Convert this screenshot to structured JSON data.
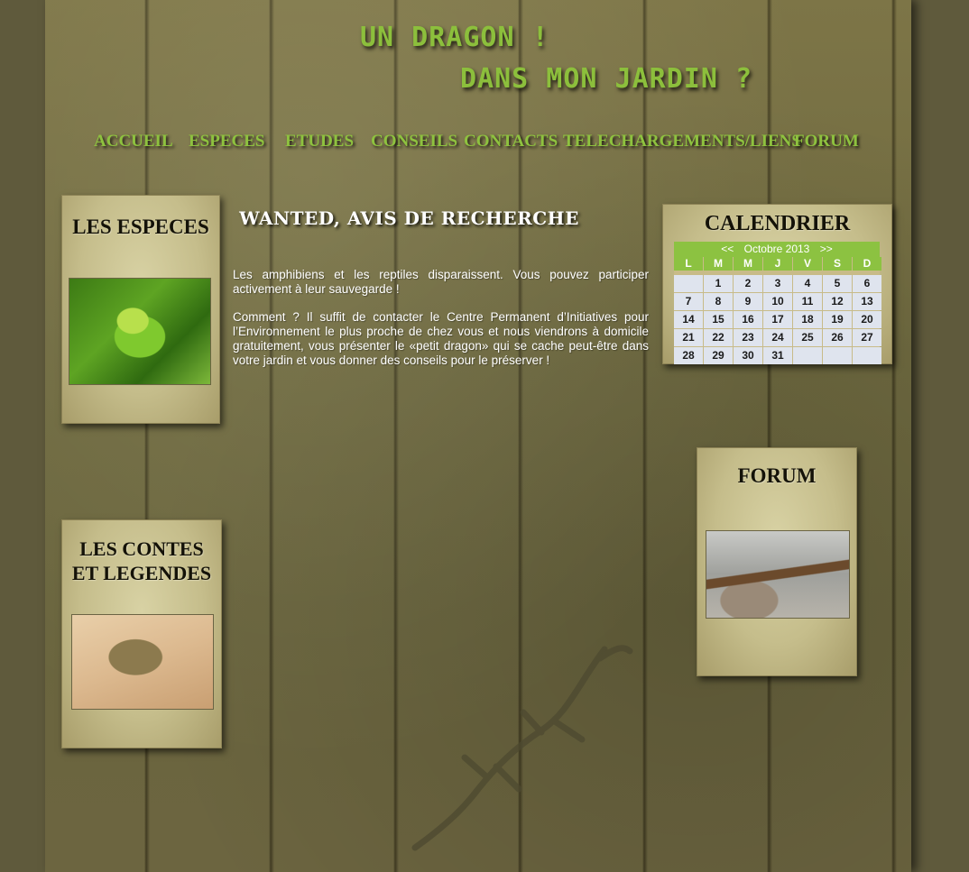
{
  "header": {
    "title_line1": "UN DRAGON !",
    "title_line2": "DANS MON JARDIN ?"
  },
  "nav": {
    "items": [
      {
        "id": "accueil",
        "label": "ACCUEIL"
      },
      {
        "id": "especes",
        "label": "ESPECES"
      },
      {
        "id": "etudes",
        "label": "ETUDES"
      },
      {
        "id": "conseils",
        "label": "CONSEILS"
      },
      {
        "id": "contacts",
        "label": "CONTACTS"
      },
      {
        "id": "telechargements",
        "label": "TELECHARGEMENTS/LIENS"
      },
      {
        "id": "forum",
        "label": "FORUM"
      }
    ]
  },
  "left_cards": {
    "especes": {
      "title": "LES ESPECES",
      "image_icon": "frog-photo"
    },
    "contes": {
      "title_line1": "LES CONTES",
      "title_line2": "ET LEGENDES",
      "image_icon": "toad-photo"
    }
  },
  "main": {
    "heading": "WANTED, AVIS DE RECHERCHE",
    "paragraph1": "Les amphibiens et les reptiles disparaissent. Vous pouvez participer activement à leur sauvegarde !",
    "paragraph2": "Comment ? Il suffit de contacter le Centre Permanent d’Initiatives pour l’Environnement le plus proche de chez vous et nous viendrons à domicile gratuitement, vous présenter le «petit dragon» qui se cache peut-être dans votre jardin et vous donner des conseils pour le préserver !"
  },
  "calendar": {
    "title": "CALENDRIER",
    "prev": "<<",
    "next": ">>",
    "month_label": "Octobre 2013",
    "weekdays": [
      "L",
      "M",
      "M",
      "J",
      "V",
      "S",
      "D"
    ],
    "weeks": [
      [
        "",
        "1",
        "2",
        "3",
        "4",
        "5",
        "6"
      ],
      [
        "7",
        "8",
        "9",
        "10",
        "11",
        "12",
        "13"
      ],
      [
        "14",
        "15",
        "16",
        "17",
        "18",
        "19",
        "20"
      ],
      [
        "21",
        "22",
        "23",
        "24",
        "25",
        "26",
        "27"
      ],
      [
        "28",
        "29",
        "30",
        "31",
        "",
        "",
        ""
      ]
    ]
  },
  "forum_card": {
    "title": "FORUM",
    "image_icon": "lizard-photo"
  },
  "colors": {
    "accent_green": "#8cc241",
    "title_green": "#8cbf3c",
    "wood": "#6f6a40"
  }
}
